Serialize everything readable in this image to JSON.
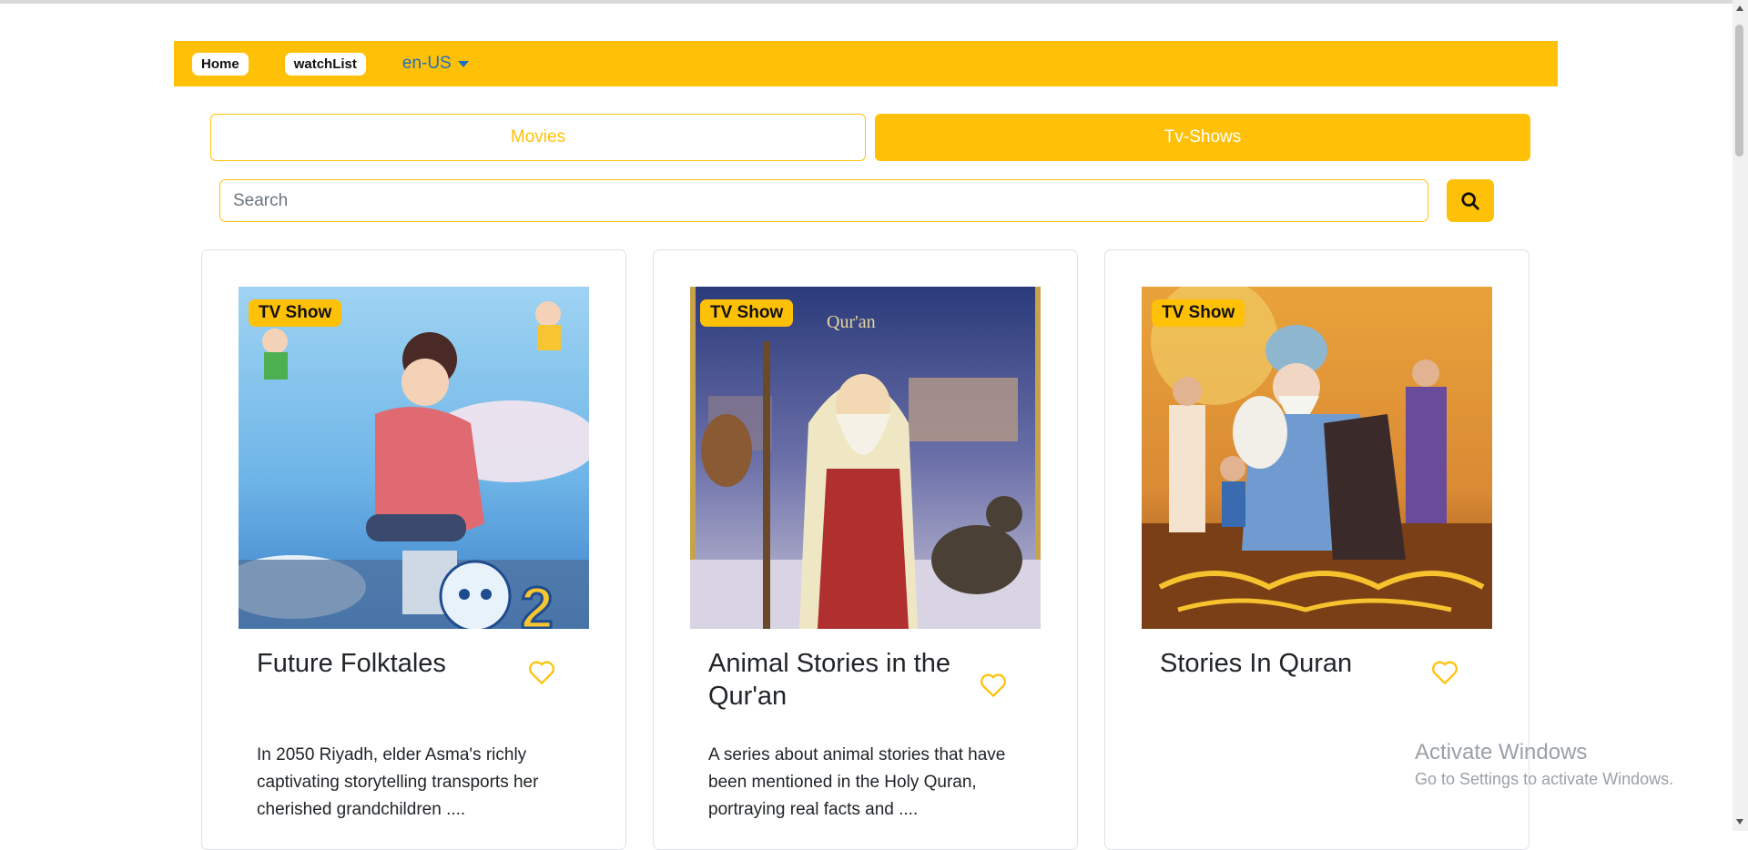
{
  "nav": {
    "home_label": "Home",
    "watchlist_label": "watchList",
    "language": "en-US"
  },
  "tabs": {
    "movies_label": "Movies",
    "tv_label": "Tv-Shows",
    "active": "Tv-Shows"
  },
  "search": {
    "placeholder": "Search",
    "value": ""
  },
  "cards": [
    {
      "badge": "TV Show",
      "title": "Future Folktales",
      "description": "In 2050 Riyadh, elder Asma's richly captivating storytelling transports her cherished grandchildren ....",
      "favorited": false
    },
    {
      "badge": "TV Show",
      "title": "Animal Stories in the Qur'an",
      "description": "A series about animal stories that have been mentioned in the Holy Quran, portraying real facts and ....",
      "favorited": false
    },
    {
      "badge": "TV Show",
      "title": "Stories In Quran",
      "description": "",
      "favorited": false
    }
  ],
  "system_watermark": {
    "title": "Activate Windows",
    "subtitle": "Go to Settings to activate Windows."
  },
  "colors": {
    "accent": "#ffc107",
    "link": "#1b6ec2"
  },
  "icons": {
    "search": "search-icon",
    "favorite": "heart-outline-icon",
    "dropdown": "caret-down-icon"
  }
}
